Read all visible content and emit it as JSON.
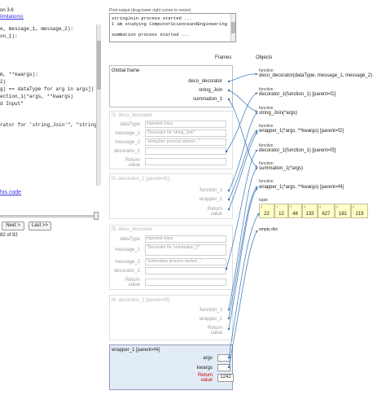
{
  "header": {
    "version": "on 3.6",
    "limitations": "limitations)"
  },
  "code": {
    "lines": [
      "e, message_1, message_2):",
      "on_1):",
      "",
      "",
      "m, **kwargs):",
      "2)",
      "g) == dataType for arg in args])",
      "ection_1(*args, **kwargs)",
      "d Input\"",
      "",
      "",
      "",
      "",
      "rator for 'string_Join'\", \"string"
    ],
    "edit_link": "his code"
  },
  "navigation": {
    "next_label": "Next >",
    "last_label": "Last >>",
    "step_text": "82 of 92"
  },
  "print_output": {
    "header": "Print output (drag lower right corner to resize)",
    "lines": [
      "stringJoin process started ...",
      "I am studying ComputerScienceandEngineering",
      "",
      "summation process started ..."
    ]
  },
  "headers": {
    "frames": "Frames",
    "objects": "Objects"
  },
  "global_frame": {
    "title": "Global frame",
    "vars": [
      "deco_decorator",
      "string_Join",
      "summation_1"
    ]
  },
  "frame_f1": {
    "title": "f1: deco_decorator",
    "vars": [
      "dataType",
      "message_1",
      "message_2",
      "decorator_1",
      "Return value"
    ],
    "values": [
      "imported class",
      "\"Decorator for 'string_Join'\"",
      "\"stringJoin process started ...\"",
      "",
      ""
    ]
  },
  "frame_f2": {
    "title": "f2: decorator_1 [parent=f1]",
    "vars": [
      "function_1",
      "wrapper_1",
      "Return value"
    ]
  },
  "frame_f3": {
    "title": "f3: deco_decorator",
    "vars": [
      "dataType",
      "message_1",
      "message_2",
      "decorator_1",
      "Return value"
    ],
    "values": [
      "imported class",
      "\"Decorator for 'summation_1'\"",
      "\"summation process started ...\"",
      "",
      ""
    ]
  },
  "frame_f4": {
    "title": "f4: decorator_1 [parent=f3]",
    "vars": [
      "function_1",
      "wrapper_1",
      "Return value"
    ]
  },
  "frame_wrapper": {
    "title": "wrapper_1 [parent=f4]",
    "vars": [
      "args",
      "kwargs",
      "Return value"
    ],
    "return_value": "1242"
  },
  "objects": [
    {
      "type": "function",
      "text": "deco_decorator(dataType, message_1, message_2)"
    },
    {
      "type": "function",
      "text": "decorator_1(function_1) [parent=f1]"
    },
    {
      "type": "function",
      "text": "string_Join(*args)"
    },
    {
      "type": "function",
      "text": "wrapper_1(*args, **kwargs) [parent=f2]"
    },
    {
      "type": "function",
      "text": "decorator_1(function_1) [parent=f3]"
    },
    {
      "type": "function",
      "text": "summation_1(*args)"
    },
    {
      "type": "function",
      "text": "wrapper_1(*args, **kwargs) [parent=f4]"
    }
  ],
  "tuple": {
    "type": "tuple",
    "indices": [
      "0",
      "1",
      "2",
      "3",
      "4",
      "5",
      "6"
    ],
    "values": [
      "22",
      "12",
      "48",
      "133",
      "627",
      "181",
      "219"
    ]
  },
  "empty_dict": {
    "text": "empty dict"
  },
  "colors": {
    "arrow": "#2b6cb0",
    "tuple_bg": "#ffffc6",
    "wrapper_frame_bg": "#e2ecf7",
    "return_label": "#c00"
  }
}
